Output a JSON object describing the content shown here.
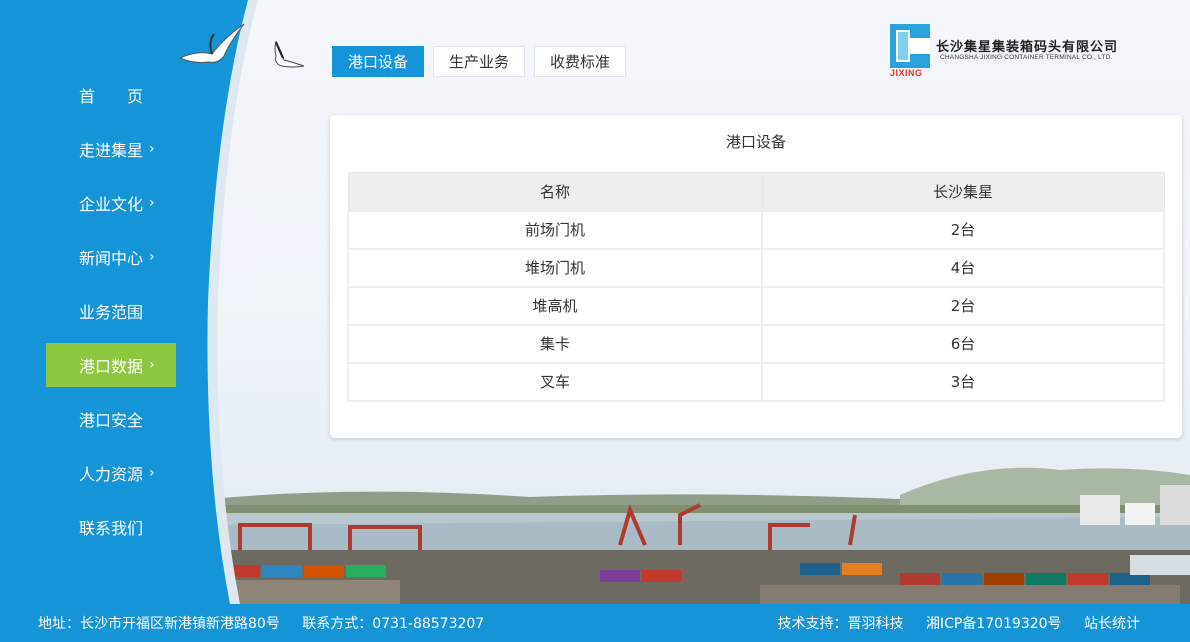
{
  "sidebar": {
    "items": [
      {
        "label": "首　　页",
        "has_arrow": false
      },
      {
        "label": "走进集星",
        "has_arrow": true
      },
      {
        "label": "企业文化",
        "has_arrow": true
      },
      {
        "label": "新闻中心",
        "has_arrow": true
      },
      {
        "label": "业务范围",
        "has_arrow": false
      },
      {
        "label": "港口数据",
        "has_arrow": true,
        "active": true
      },
      {
        "label": "港口安全",
        "has_arrow": false
      },
      {
        "label": "人力资源",
        "has_arrow": true
      },
      {
        "label": "联系我们",
        "has_arrow": false
      }
    ],
    "arrow": "›"
  },
  "tabs": [
    {
      "label": "港口设备",
      "active": true
    },
    {
      "label": "生产业务"
    },
    {
      "label": "收费标准"
    }
  ],
  "logo": {
    "mark_text": "JIXING",
    "name_cn": "长沙集星集装箱码头有限公司",
    "name_en": "CHANGSHA JIXING CONTAINER TERMINAL CO., LTD."
  },
  "card": {
    "title": "港口设备",
    "columns": [
      "名称",
      "长沙集星"
    ],
    "rows": [
      [
        "前场门机",
        "2台"
      ],
      [
        "堆场门机",
        "4台"
      ],
      [
        "堆高机",
        "2台"
      ],
      [
        "集卡",
        "6台"
      ],
      [
        "叉车",
        "3台"
      ]
    ]
  },
  "footer": {
    "address": "地址：长沙市开福区新港镇新港路80号",
    "contact": "联系方式：0731-88573207",
    "support": "技术支持：晋羽科技",
    "icp": "湘ICP备17019320号",
    "stats": "站长统计"
  },
  "colors": {
    "primary_blue": "#1594d8",
    "active_green": "#8dc63f",
    "logo_red": "#e5332a"
  }
}
